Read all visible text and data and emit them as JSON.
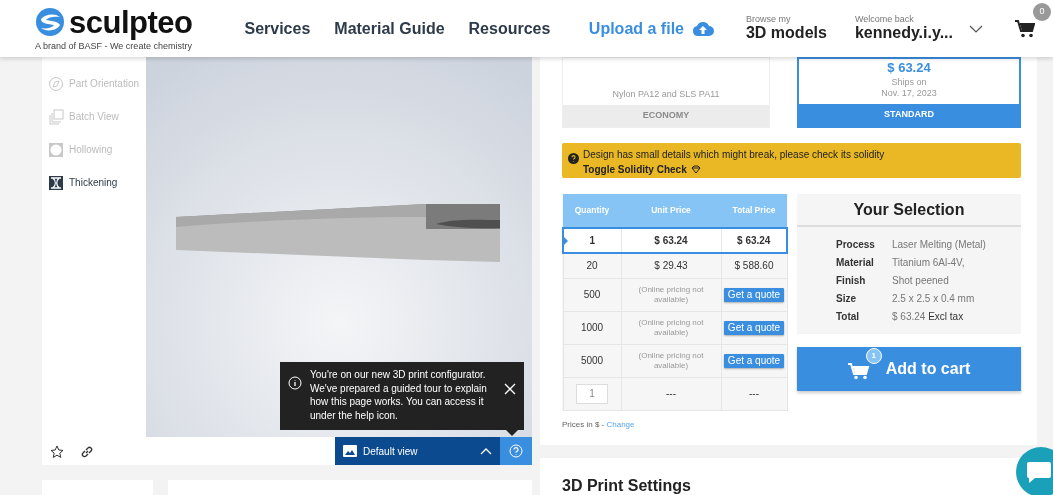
{
  "brand": {
    "name": "sculpteo",
    "tagline": "A brand of BASF - We create chemistry"
  },
  "nav": [
    {
      "label": "Services"
    },
    {
      "label": "Material Guide"
    },
    {
      "label": "Resources"
    }
  ],
  "upload": {
    "label": "Upload a file"
  },
  "models": {
    "caption": "Browse my",
    "label": "3D models"
  },
  "account": {
    "caption": "Welcome back",
    "label": "kennedy.i.y..."
  },
  "cart_count": "0",
  "tools": [
    {
      "label": "Part Orientation",
      "kind": "orientation",
      "enabled": false
    },
    {
      "label": "Batch View",
      "kind": "batch",
      "enabled": false
    },
    {
      "label": "Hollowing",
      "kind": "hollow",
      "enabled": false
    },
    {
      "label": "Thickening",
      "kind": "thicken",
      "enabled": true
    }
  ],
  "viewer": {
    "view_button": "Default view",
    "tooltip": "You're on our new 3D print configurator. We've prepared a guided tour to explain how this page works. You can access it under the help icon."
  },
  "delivery": [
    {
      "name": "ECONOMY",
      "note": "Nylon PA12 and SLS PA11",
      "selected": false
    },
    {
      "name": "STANDARD",
      "price": "$ 63.24",
      "ships": "Ships on",
      "date": "Nov. 17, 2023",
      "selected": true
    }
  ],
  "warning": {
    "message": "Design has small details which might break, please check its solidity",
    "link": "Toggle Solidity Check"
  },
  "pricing": {
    "columns": [
      "Quantity",
      "Unit Price",
      "Total Price"
    ],
    "rows": [
      {
        "quantity": "1",
        "unit": "$ 63.24",
        "total": "$ 63.24",
        "selected": true
      },
      {
        "quantity": "20",
        "unit": "$ 29.43",
        "total": "$ 588.60",
        "selected": false
      },
      {
        "quantity": "500",
        "unit": "(Online pricing not available)",
        "action": "Get a quote",
        "selected": false
      },
      {
        "quantity": "1000",
        "unit": "(Online pricing not available)",
        "action": "Get a quote",
        "selected": false
      },
      {
        "quantity": "5000",
        "unit": "(Online pricing not available)",
        "action": "Get a quote",
        "selected": false
      }
    ],
    "custom": {
      "value": "1",
      "unit": "---",
      "total": "---"
    },
    "note": "Prices in $ -",
    "link": "Change"
  },
  "selection": {
    "title": "Your Selection",
    "rows": [
      {
        "label": "Process",
        "value": "Laser Melting (Metal)"
      },
      {
        "label": "Material",
        "value": "Titanium 6Al-4V,"
      },
      {
        "label": "Finish",
        "value": "Shot peened"
      },
      {
        "label": "Size",
        "value": "2.5 x 2.5 x 0.4 mm"
      },
      {
        "label": "Total",
        "value": "$ 63.24",
        "suffix": "Excl tax"
      }
    ]
  },
  "add_to_cart": {
    "label": "Add to cart",
    "badge": "1"
  },
  "settings_title": "3D Print Settings"
}
